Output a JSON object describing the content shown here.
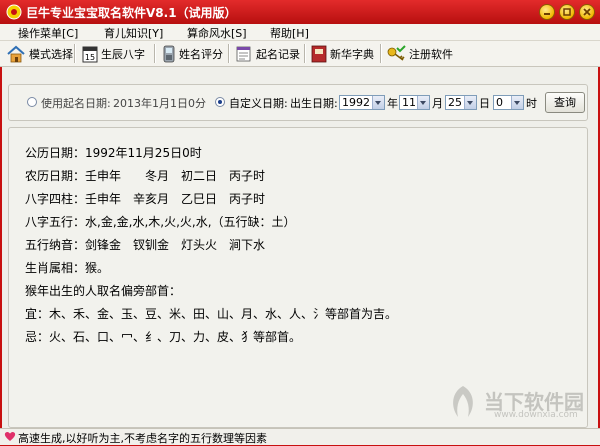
{
  "window": {
    "title": "巨牛专业宝宝取名软件V8.1（试用版）"
  },
  "menu": [
    {
      "label": "操作菜单[C]"
    },
    {
      "label": "育儿知识[Y]"
    },
    {
      "label": "算命风水[S]"
    },
    {
      "label": "帮助[H]"
    }
  ],
  "toolbar": [
    {
      "label": "模式选择",
      "icon": "house-icon"
    },
    {
      "label": "生辰八字",
      "icon": "calendar-icon"
    },
    {
      "label": "姓名评分",
      "icon": "phone-icon"
    },
    {
      "label": "起名记录",
      "icon": "record-icon"
    },
    {
      "label": "新华字典",
      "icon": "dictionary-icon"
    },
    {
      "label": "注册软件",
      "icon": "key-icon"
    }
  ],
  "date": {
    "use_date_label": "使用起名日期:",
    "use_date_value": "2013年1月1日0分",
    "custom_label": "自定义日期:",
    "birth_label": "出生日期:",
    "year": "1992",
    "year_unit": "年",
    "month": "11",
    "month_unit": "月",
    "day": "25",
    "day_unit": "日",
    "hour": "0",
    "hour_unit": "时",
    "query_label": "查询"
  },
  "result": {
    "lines": [
      "公历日期：1992年11月25日0时",
      "农历日期：壬申年　　冬月　初二日　丙子时",
      "八字四柱：壬申年　辛亥月　乙巳日　丙子时",
      "八字五行：水,金,金,水,木,火,火,水,（五行缺：土）",
      "五行纳音：剑锋金　钗钏金　灯头火　涧下水",
      "生肖属相：猴。",
      "猴年出生的人取名偏旁部首：",
      "宜：木、禾、金、玉、豆、米、田、山、月、水、人、氵等部首为吉。",
      "忌：火、石、口、冖、纟、刀、力、皮、犭等部首。"
    ]
  },
  "watermark": {
    "brand_cn": "当下软件园",
    "url": "www.downxia.com"
  },
  "status": {
    "text": "高速生成,以好听为主,不考虑名字的五行数理等因素"
  },
  "colors": {
    "title_bar": "#c81010",
    "window_button": "#f2b800",
    "panel_bg": "#efefea"
  }
}
